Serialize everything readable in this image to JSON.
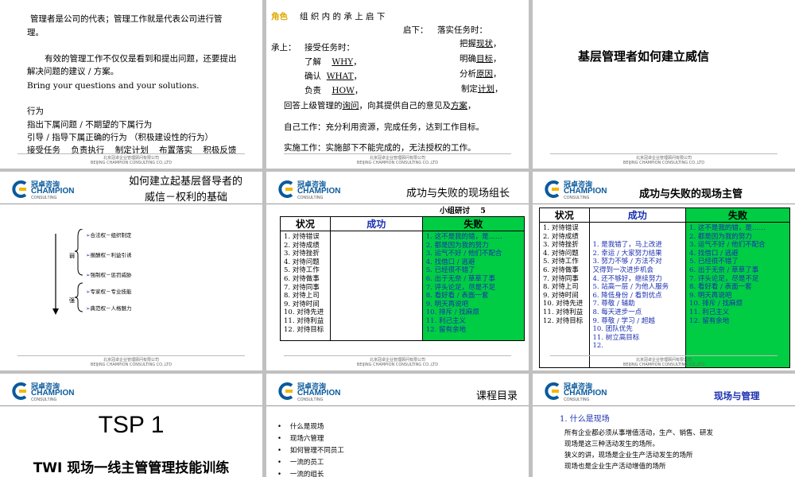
{
  "footer": {
    "cn": "北京冠卓企业管理顾问有限公司",
    "en": "BEIJING CHAMPION CONSULTING CO.,LTD"
  },
  "logo": {
    "cn": "冠卓咨询",
    "en": "CHAMPION",
    "sub": "CONSULTING"
  },
  "slide1": {
    "p1": "管理者是公司的代表；管理工作就是代表公司进行管",
    "p1b": "理。",
    "p2": "有效的管理工作不仅仅是看到和提出问题，还要提出",
    "p2b": "解决问题的建议 / 方案。",
    "p3": "Bring your questions and your solutions.",
    "p4": "行为",
    "p5": "指出下属问题 / 不期望的下属行为",
    "p6": "引导 / 指导下属正确的行为 （积极建设性的行为）",
    "p7": "接受任务    负责执行    制定计划    布置落实    积极反馈"
  },
  "slide2": {
    "role": "角色",
    "title": "组 织 内 的 承 上 启 下",
    "down": "启下：",
    "down_task": "落实任务时：",
    "d1a": "把握",
    "d1b": "现状",
    "d2a": "明确",
    "d2b": "目标",
    "d3a": "分析",
    "d3b": "原因",
    "d4a": "制定",
    "d4b": "计划",
    "up": "承上：",
    "up_task": "接受任务时：",
    "u1a": "了解",
    "u1b": "WHY",
    "u2a": "确认",
    "u2b": "WHAT",
    "u3a": "负责",
    "u3b": "HOW",
    "l1a": "回答上级管理的",
    "l1b": "询问",
    "l1c": "，向其提供自己的意见及",
    "l1d": "方案",
    "l2": "自己工作：充分利用资源，完成任务，达到工作目标。",
    "l3": "实施工作：实施部下不能完成的，无法授权的工作。"
  },
  "slide3": {
    "title": "基层管理者如何建立威信"
  },
  "slide4": {
    "title1": "如何建立起基层督导者的",
    "title2": "威信－权利的基础",
    "weak": "弱",
    "strong": "强",
    "items": [
      "合法权－组织制定",
      "报酬权－利益引诱",
      "强制权－惩罚威胁",
      "专家权－专业技能",
      "典范权－人格魅力"
    ]
  },
  "slide5": {
    "title": "成功与失败的现场组长",
    "group": "小组研讨    5",
    "h_status": "状况",
    "h_success": "成功",
    "h_fail": "失败",
    "status": [
      "1.    对待错误",
      "2.    对待成绩",
      "3.    对待挫折",
      "4.    对待问题",
      "5.    对待工作",
      "6.    对待做事",
      "7.    对待同事",
      "8.    对待上司",
      "9.    对待时间",
      "10.  对待先进",
      "11.  对待利益",
      "12.  对待目标"
    ],
    "fail": [
      "1. 这不是我的错，是……",
      "2. 都是因为我的努力",
      "3. 运气不好 / 他们不配合",
      "4. 找借口 / 逃避",
      "5. 已经很不错了",
      "6. 出于无奈 / 草草了事",
      "7. 评头论足，尽是不足",
      "8. 看好看 / 表面一套",
      "9. 明天再说吧",
      "10. 排斥 / 找麻烦",
      "11. 利己主义",
      "12. 留有余地"
    ]
  },
  "slide6": {
    "title": "成功与失败的现场主管",
    "h_status": "状况",
    "h_success": "成功",
    "h_fail": "失败",
    "status": [
      "1.    对待错误",
      "2.    对待成绩",
      "3.    对待挫折",
      "4.    对待问题",
      "5.    对待工作",
      "6.    对待做事",
      "7.    对待同事",
      "8.    对待上司",
      "9.    对待时间",
      "10.  对待先进",
      "11.  对待利益",
      "12.  对待目标"
    ],
    "success": [
      "1.    是我错了，马上改进",
      "2.    幸运 / 大家努力结果",
      "3.    努力不够 / 方法不对",
      "      又得到一次进步机会",
      "4.    还不够好，继续努力",
      "5.    站高一层 / 为他人服务",
      "6.    降低身份 / 看到优点",
      "7.    尊敬 / 辅助",
      "8.    每天进步一点",
      "9.    尊敬 / 学习 / 超越",
      "10.  团队优先",
      "11.  树立高目标",
      "12."
    ],
    "fail": [
      "1. 这不是我的错，是……",
      "2. 都是因为我的努力",
      "3. 运气不好 / 他们不配合",
      "4. 找借口 / 逃避",
      "5. 已经很不错了",
      "6. 出于无奈 / 草草了事",
      "7. 评头论足，尽是不足",
      "8. 看好看 / 表面一套",
      "9. 明天再说吧",
      "10. 排斥 / 找麻烦",
      "11. 利己主义",
      "12. 留有余地"
    ]
  },
  "slide7": {
    "title1": "TSP 1",
    "title2": "TWI 现场一线主管管理技能训练"
  },
  "slide8": {
    "title": "课程目录",
    "items": [
      "什么是现场",
      "现场六管理",
      "如何管理不同员工",
      "一流的员工",
      "一流的组长"
    ]
  },
  "slide9": {
    "title": "现场与管理",
    "sub": "1.  什么是现场",
    "l1": "所有企业都必须从事增值活动，生产、销售、研发",
    "l2": "现场是这三种活动发生的场所。",
    "l3": "狭义的讲，现场是企业生产活动发生的场所",
    "l4": "现场也是企业生产活动增值的场所"
  }
}
